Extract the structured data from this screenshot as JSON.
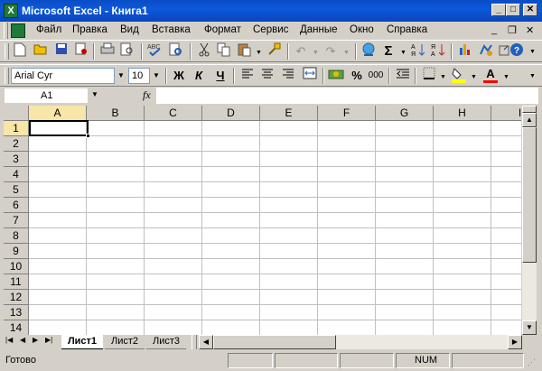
{
  "window": {
    "title": "Microsoft Excel - Книга1"
  },
  "menu": {
    "items": [
      "Файл",
      "Правка",
      "Вид",
      "Вставка",
      "Формат",
      "Сервис",
      "Данные",
      "Окно",
      "Справка"
    ]
  },
  "formatting": {
    "font_name": "Arial Cyr",
    "font_size": "10",
    "bold": "Ж",
    "italic": "К",
    "underline": "Ч",
    "percent": "%",
    "thousands": "000",
    "font_color_glyph": "A"
  },
  "standard": {
    "sum_glyph": "Σ"
  },
  "formula_bar": {
    "name_box": "A1",
    "fx": "fx",
    "content": ""
  },
  "grid": {
    "columns": [
      "A",
      "B",
      "C",
      "D",
      "E",
      "F",
      "G",
      "H",
      "I"
    ],
    "rows": [
      "1",
      "2",
      "3",
      "4",
      "5",
      "6",
      "7",
      "8",
      "9",
      "10",
      "11",
      "12",
      "13",
      "14"
    ],
    "active_cell": "A1"
  },
  "sheets": {
    "tabs": [
      "Лист1",
      "Лист2",
      "Лист3"
    ],
    "active": "Лист1"
  },
  "status": {
    "ready": "Готово",
    "num": "NUM"
  },
  "colors": {
    "title_bar": "#0a4cc4",
    "face": "#d4d0c8",
    "highlight_fill": "#ffff00",
    "font_color": "#ff0000"
  }
}
